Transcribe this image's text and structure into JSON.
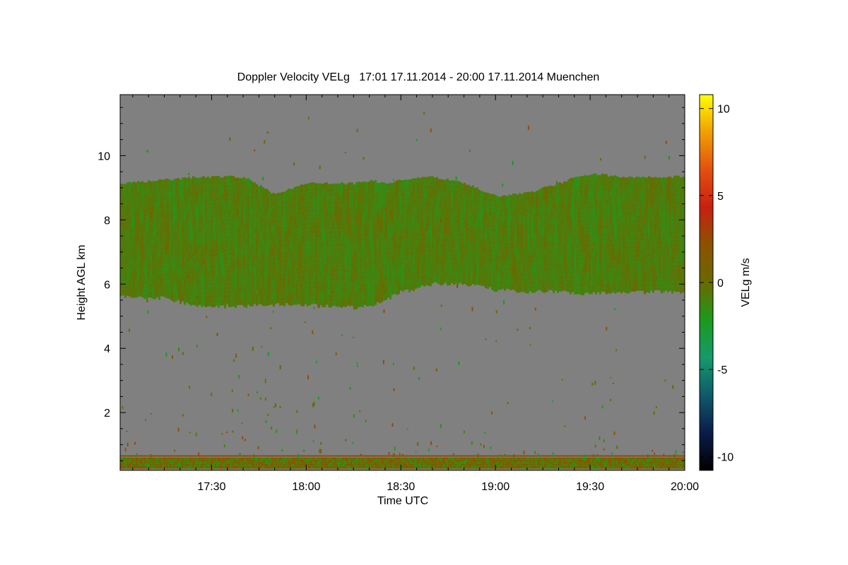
{
  "chart_data": {
    "type": "heatmap",
    "title": "Doppler Velocity VELg   17:01 17.11.2014 - 20:00 17.11.2014 Muenchen",
    "xlabel": "Time UTC",
    "ylabel": "Height AGL km",
    "colorbar_label": "VELg m/s",
    "xlim_minutes_utc": [
      1021,
      1200
    ],
    "ylim_km": [
      0.2,
      11.9
    ],
    "x_ticks": [
      {
        "minutes": 1050,
        "label": "17:30"
      },
      {
        "minutes": 1080,
        "label": "18:00"
      },
      {
        "minutes": 1110,
        "label": "18:30"
      },
      {
        "minutes": 1140,
        "label": "19:00"
      },
      {
        "minutes": 1170,
        "label": "19:30"
      },
      {
        "minutes": 1200,
        "label": "20:00"
      }
    ],
    "y_ticks": [
      {
        "value": 2,
        "label": "2"
      },
      {
        "value": 4,
        "label": "4"
      },
      {
        "value": 6,
        "label": "6"
      },
      {
        "value": 8,
        "label": "8"
      },
      {
        "value": 10,
        "label": "10"
      }
    ],
    "colorbar": {
      "range": [
        -10.8,
        10.8
      ],
      "ticks": [
        {
          "value": 10,
          "label": "10"
        },
        {
          "value": 5,
          "label": "5"
        },
        {
          "value": 0,
          "label": "0"
        },
        {
          "value": -5,
          "label": "-5"
        },
        {
          "value": -10,
          "label": "-10"
        }
      ],
      "colors": [
        "#000000",
        "#0a1c4a",
        "#0f5a6a",
        "#159a6a",
        "#1c9a1c",
        "#6a6a00",
        "#8b5200",
        "#c82010",
        "#e25010",
        "#f0a000",
        "#ffff00"
      ]
    },
    "no_signal_color": "#808080",
    "cloud_layer": {
      "description_values": "cloud echo band, height in km",
      "time_minutes": [
        1021,
        1035,
        1045,
        1050,
        1055,
        1060,
        1070,
        1080,
        1095,
        1100,
        1105,
        1110,
        1115,
        1120,
        1130,
        1140,
        1150,
        1160,
        1165,
        1170,
        1180,
        1190,
        1200
      ],
      "base_km": [
        5.6,
        5.55,
        5.3,
        5.25,
        5.3,
        5.3,
        5.35,
        5.35,
        5.25,
        5.3,
        5.5,
        5.75,
        5.85,
        6.0,
        6.0,
        5.8,
        5.75,
        5.75,
        5.7,
        5.7,
        5.7,
        5.75,
        5.75
      ],
      "top_km": [
        9.1,
        9.2,
        9.3,
        9.3,
        9.3,
        9.3,
        8.75,
        9.1,
        9.1,
        9.2,
        9.1,
        9.2,
        9.3,
        9.3,
        9.1,
        8.7,
        8.8,
        9.1,
        9.3,
        9.4,
        9.3,
        9.3,
        9.3
      ],
      "mean_velocity_ms": -0.8
    },
    "surface_layer": {
      "base_km": 0.25,
      "top_km": 0.6,
      "red_line_km": 0.65,
      "mean_velocity_ms": 0.3
    }
  }
}
